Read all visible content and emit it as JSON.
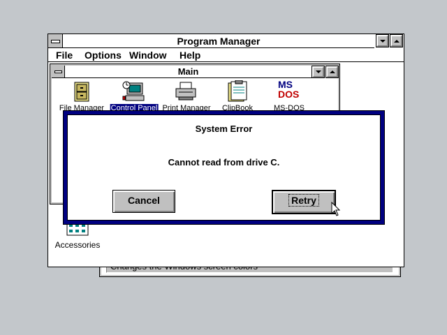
{
  "program_manager": {
    "title": "Program Manager",
    "menu": [
      "File",
      "Options",
      "Window",
      "Help"
    ]
  },
  "main_group": {
    "title": "Main",
    "icons": [
      {
        "label": "File Manager",
        "icon": "file-cabinet-icon"
      },
      {
        "label": "Control Panel",
        "icon": "control-panel-icon",
        "selected": true
      },
      {
        "label": "Print Manager",
        "icon": "printer-icon"
      },
      {
        "label": "ClipBook",
        "icon": "clipbook-icon"
      },
      {
        "label": "MS-DOS",
        "icon": "ms-dos-icon"
      }
    ],
    "ms_dos_logo_text": [
      "MS",
      "DOS"
    ]
  },
  "accessories_group": {
    "icon_label": "Accessories"
  },
  "status_bar": {
    "text": "Changes the Windows screen colors"
  },
  "dialog": {
    "title": "System Error",
    "message": "Cannot read from drive C.",
    "buttons": {
      "cancel": "Cancel",
      "retry": "Retry"
    }
  },
  "colors": {
    "desktop": "#c3c7cb",
    "dialog_border": "#000080",
    "selection": "#000080"
  }
}
